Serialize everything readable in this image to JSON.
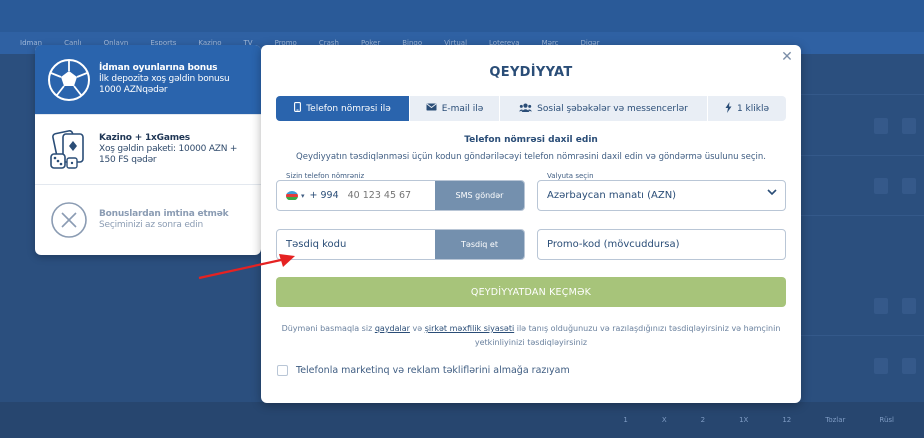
{
  "background": {
    "nav_items": [
      "Idman",
      "Canlı",
      "Onlayn",
      "Esports",
      "Kazino",
      "TV",
      "Promo",
      "Crash",
      "Poker",
      "Bingo",
      "Virtual",
      "Lotereya",
      "Mərc",
      "Digər"
    ],
    "bottom_cells": [
      "1",
      "X",
      "2",
      "1X",
      "12",
      "Tozlar",
      "Rüsl"
    ]
  },
  "bonus": {
    "items": [
      {
        "title": "İdman oyunlarına bonus",
        "desc": "İlk depozitə xoş gəldin bonusu 1000 AZNqədər"
      },
      {
        "title": "Kazino + 1xGames",
        "desc": "Xoş gəldin paketi: 10000 AZN + 150 FS qədər"
      },
      {
        "title": "Bonuslardan imtina etmək",
        "desc": "Seçiminizi az sonra edin"
      }
    ]
  },
  "modal": {
    "title": "QEYDİYYAT",
    "close_label": "✕",
    "tabs": [
      {
        "label": "Telefon nömrəsi ilə",
        "icon": "phone-icon"
      },
      {
        "label": "E-mail ilə",
        "icon": "envelope-icon"
      },
      {
        "label": "Sosial şəbəkələr və messencerlər",
        "icon": "users-icon"
      },
      {
        "label": "1 kliklə",
        "icon": "lightning-icon"
      }
    ],
    "subtitle": "Telefon nömrəsi daxil edin",
    "description": "Qeydiyyatın təsdiqlənməsi üçün kodun göndəriləcəyi telefon nömrəsini daxil edin və göndərmə üsulunu seçin.",
    "phone": {
      "label": "Sizin telefon nömrəniz",
      "country_code": "+ 994",
      "placeholder": "40 123 45 67",
      "sms_button": "SMS göndər"
    },
    "currency": {
      "label": "Valyuta seçin",
      "value": "Azərbaycan manatı (AZN)"
    },
    "confirm": {
      "placeholder": "Təsdiq kodu",
      "button": "Təsdiq et"
    },
    "promo": {
      "placeholder": "Promo-kod (mövcuddursa)"
    },
    "register_button": "QEYDİYYATDAN KEÇMƏK",
    "terms": {
      "prefix": "Düyməni basmaqla siz ",
      "link1": "qaydalar",
      "mid": " və ",
      "link2": "şirkət məxfilik siyasəti",
      "suffix": " ilə tanış olduğunuzu və razılaşdığınızı təsdiqləyirsiniz və həmçinin yetkinliyinizi təsdiqləyirsiniz"
    },
    "marketing_label": "Telefonla marketinq və reklam təkliflərini almağa razıyam"
  },
  "colors": {
    "accent": "#2a64ad",
    "register_button": "#a7c47a",
    "secondary_button": "#7490ae",
    "arrow": "#e52222"
  }
}
